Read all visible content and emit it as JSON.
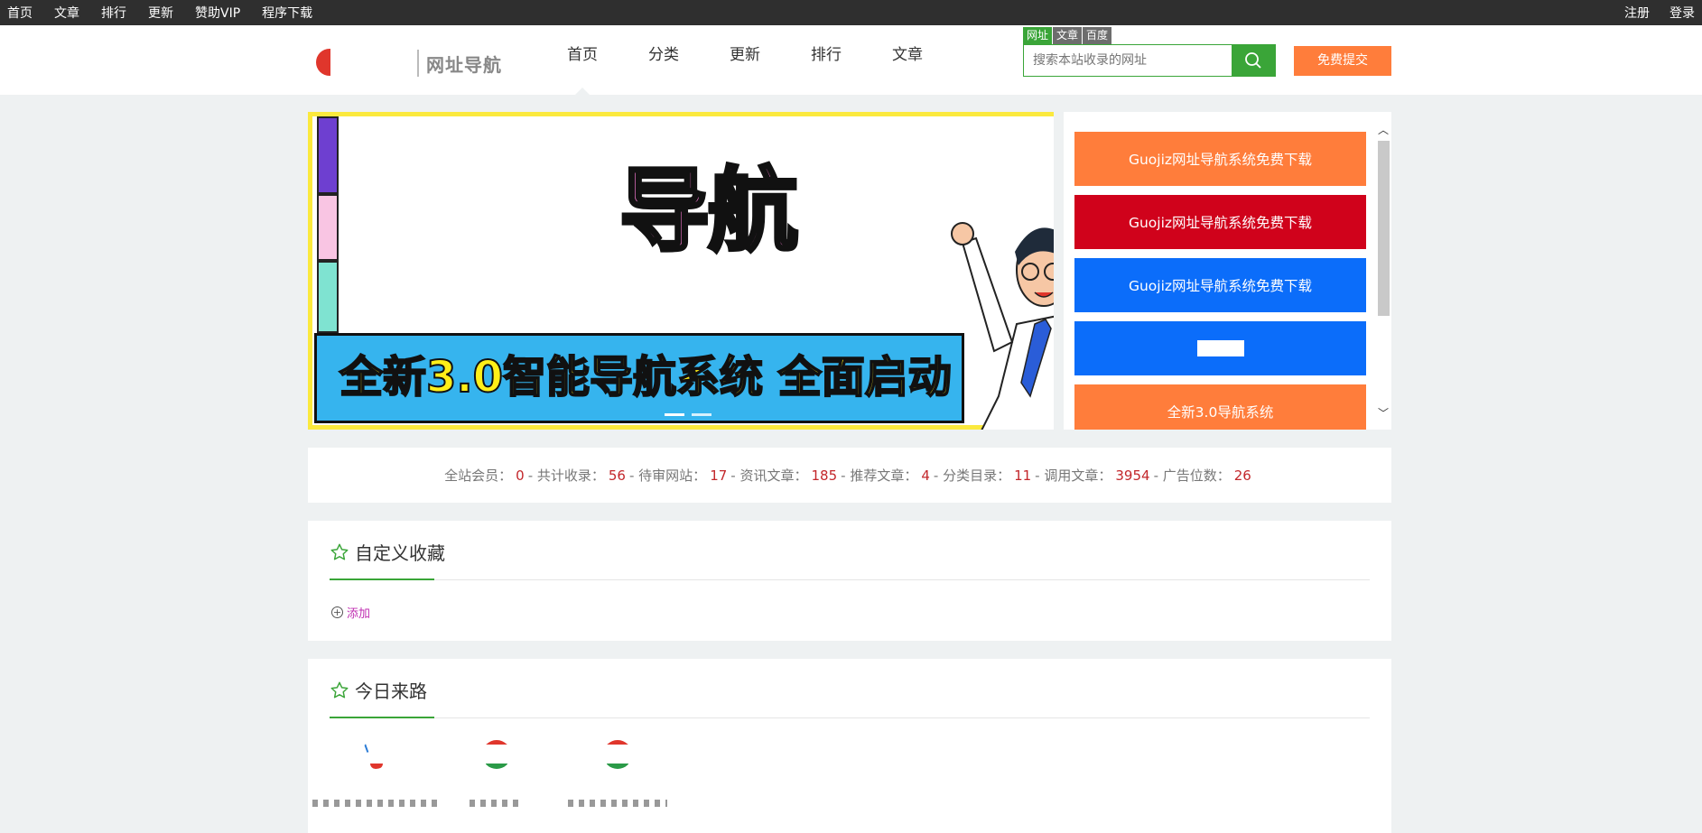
{
  "topbar": {
    "links": [
      "首页",
      "文章",
      "排行",
      "更新",
      "赞助VIP",
      "程序下载"
    ],
    "register": "注册",
    "login": "登录"
  },
  "header": {
    "logo_text": "网址导航",
    "nav": [
      "首页",
      "分类",
      "更新",
      "排行",
      "文章"
    ],
    "active_nav": 0,
    "search_tabs": [
      "网址",
      "文章",
      "百度"
    ],
    "search_placeholder": "搜索本站收录的网址",
    "submit_label": "免费提交"
  },
  "banner": {
    "title": "导航",
    "slogan": "全新3.0智能导航系统  全面启动",
    "slides": 2,
    "active_slide": 0
  },
  "ads": [
    {
      "label": "Guojiz网址导航系统免费下载",
      "color": "#ff7d3b"
    },
    {
      "label": "Guojiz网址导航系统免费下载",
      "color": "#d0021b"
    },
    {
      "label": "Guojiz网址导航系统免费下载",
      "color": "#0b6dfa"
    },
    {
      "label": "",
      "color": "#0b6dfa"
    },
    {
      "label": "全新3.0导航系统",
      "color": "#ff7d3b"
    }
  ],
  "stats": [
    {
      "label": "全站会员：",
      "value": "0"
    },
    {
      "label": "共计收录：",
      "value": "56"
    },
    {
      "label": "待审网站：",
      "value": "17"
    },
    {
      "label": "资讯文章：",
      "value": "185"
    },
    {
      "label": "推荐文章：",
      "value": "4"
    },
    {
      "label": "分类目录：",
      "value": "11"
    },
    {
      "label": "调用文章：",
      "value": "3954"
    },
    {
      "label": "广告位数：",
      "value": "26"
    }
  ],
  "favorites": {
    "title": "自定义收藏",
    "add_label": "添加"
  },
  "today": {
    "title": "今日来路"
  },
  "colors": {
    "accent": "#3aa538",
    "orange": "#ff7d3b",
    "value_red": "#c3272b"
  }
}
